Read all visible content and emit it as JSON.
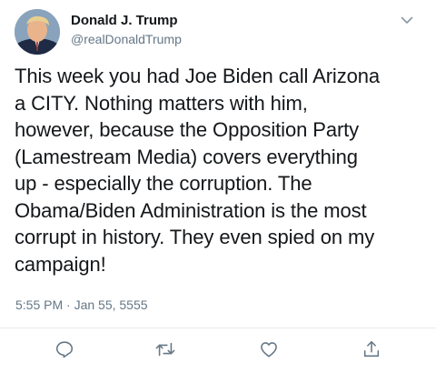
{
  "tweet": {
    "author": {
      "display_name": "Donald J. Trump",
      "handle": "@realDonaldTrump"
    },
    "text": "This week you had Joe Biden call Arizona\na CITY. Nothing matters with him,\nhowever, because the Opposition Party\n(Lamestream Media) covers everything\nup - especially the corruption. The\nObama/Biden Administration is the most\ncorrupt in history. They even spied on my\ncampaign!",
    "timestamp": "5:55 PM · Jan 55, 5555",
    "actions": [
      {
        "name": "reply",
        "icon": "comment-icon"
      },
      {
        "name": "retweet",
        "icon": "retweet-icon"
      },
      {
        "name": "like",
        "icon": "heart-icon"
      },
      {
        "name": "share",
        "icon": "share-icon"
      }
    ]
  },
  "colors": {
    "primary_text": "#14171a",
    "secondary_text": "#657786",
    "action_icon": "#657786",
    "divider": "#e6ecf0",
    "background": "#ffffff"
  }
}
